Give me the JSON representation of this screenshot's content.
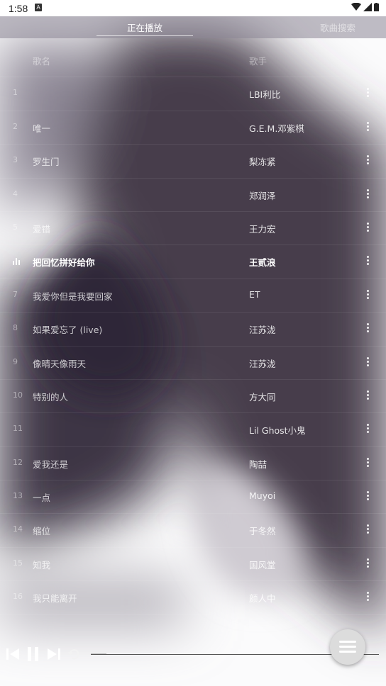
{
  "status_bar": {
    "time": "1:58",
    "notification_icon": "A"
  },
  "tabs": [
    {
      "label": "",
      "active": false
    },
    {
      "label": "正在播放",
      "active": true
    },
    {
      "label": "",
      "active": false
    },
    {
      "label": "歌曲搜索",
      "active": false
    }
  ],
  "header": {
    "title": "歌名",
    "artist": "歌手"
  },
  "songs": [
    {
      "num": "1",
      "title": "",
      "artist": "LBI利比"
    },
    {
      "num": "2",
      "title": "唯一",
      "artist": "G.E.M.邓紫棋"
    },
    {
      "num": "3",
      "title": "罗生门",
      "artist": "梨冻紧"
    },
    {
      "num": "4",
      "title": "",
      "artist": "郑润泽"
    },
    {
      "num": "5",
      "title": "爱错",
      "artist": "王力宏"
    },
    {
      "num": "6",
      "title": "把回忆拼好给你",
      "artist": "王贰浪",
      "playing": true
    },
    {
      "num": "7",
      "title": "我爱你但是我要回家",
      "artist": "ET"
    },
    {
      "num": "8",
      "title": "如果爱忘了 (live)",
      "artist": "汪苏泷"
    },
    {
      "num": "9",
      "title": "像晴天像雨天",
      "artist": "汪苏泷"
    },
    {
      "num": "10",
      "title": "特别的人",
      "artist": "方大同"
    },
    {
      "num": "11",
      "title": "",
      "artist": "Lil Ghost小鬼"
    },
    {
      "num": "12",
      "title": "爱我还是",
      "artist": "陶喆"
    },
    {
      "num": "13",
      "title": "一点",
      "artist": "Muyoi"
    },
    {
      "num": "14",
      "title": "缩位",
      "artist": "于冬然"
    },
    {
      "num": "15",
      "title": "知我",
      "artist": "国风堂"
    },
    {
      "num": "16",
      "title": "我只能离开",
      "artist": "颜人中"
    }
  ],
  "icons": {
    "more": "more-vert-icon",
    "prev": "skip-previous-icon",
    "pause": "pause-icon",
    "next": "skip-next-icon",
    "loop": "repeat-icon",
    "menu": "menu-icon",
    "playing": "equalizer-icon"
  },
  "player": {
    "progress": 0.03
  }
}
